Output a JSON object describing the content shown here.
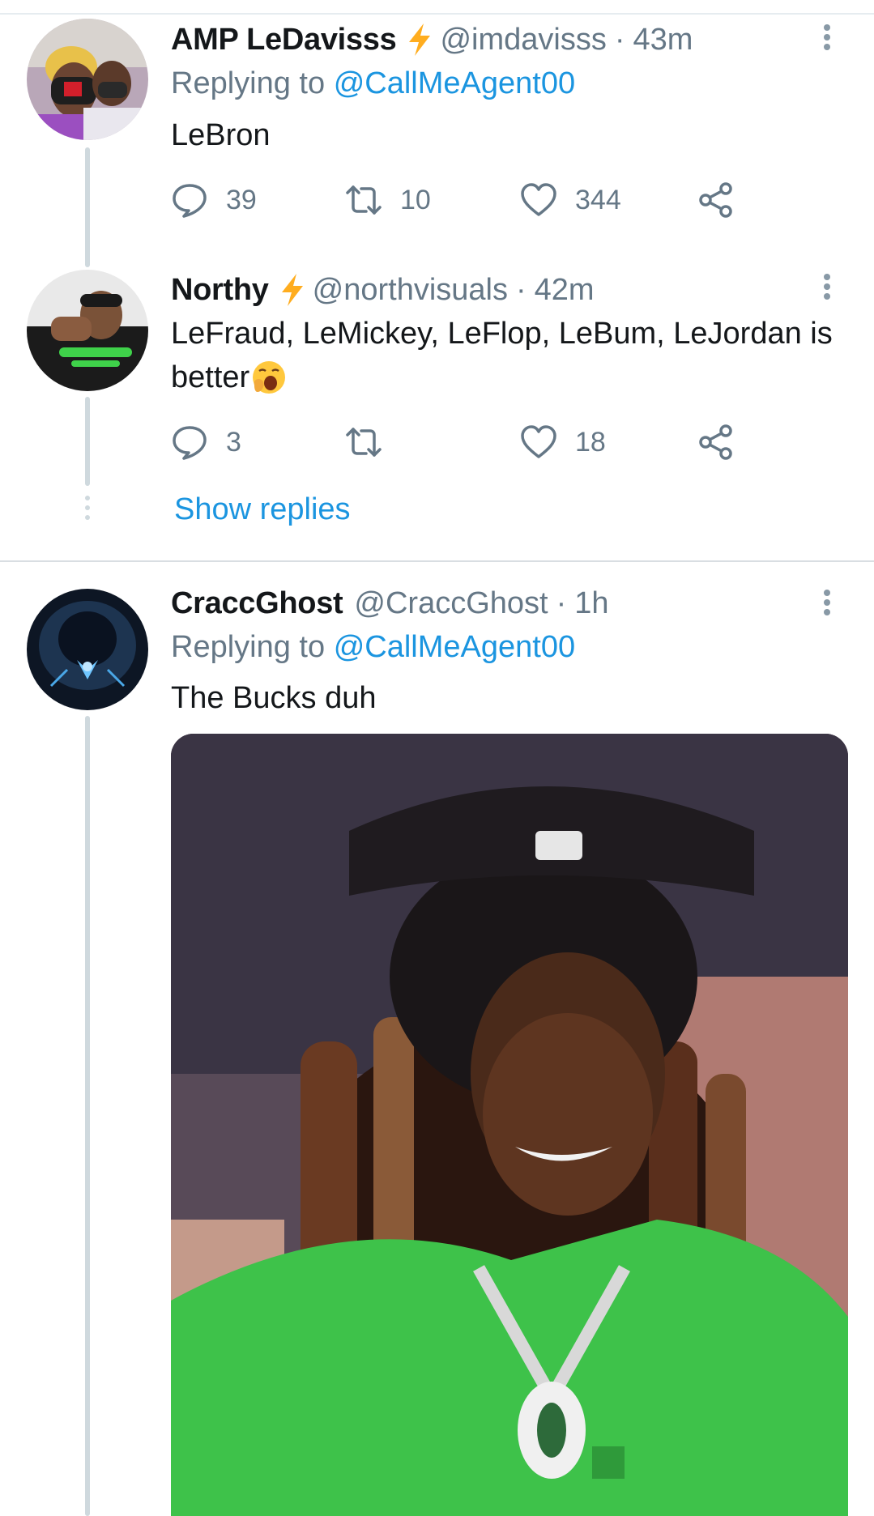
{
  "tweets": [
    {
      "name": "AMP LeDavisss",
      "verified_bolt": true,
      "handle": "@imdavisss",
      "separator": "·",
      "time": "43m",
      "replying_prefix": "Replying to",
      "replying_to": "@CallMeAgent00",
      "text": "LeBron",
      "replies": "39",
      "retweets": "10",
      "likes": "344"
    },
    {
      "name": "Northy",
      "verified_bolt": true,
      "handle": "@northvisuals",
      "separator": "·",
      "time": "42m",
      "text": "LeFraud, LeMickey, LeFlop, LeBum, LeJordan is better",
      "emoji": "yawning-face",
      "replies": "3",
      "retweets": "",
      "likes": "18"
    },
    {
      "name": "CraccGhost",
      "handle": "@CraccGhost",
      "separator": "·",
      "time": "1h",
      "replying_prefix": "Replying to",
      "replying_to": "@CallMeAgent00",
      "text": "The Bucks duh",
      "media": "photo-smiling-man-green-shirt"
    }
  ],
  "show_replies": "Show replies",
  "colors": {
    "link": "#1b95e0",
    "muted": "#657786",
    "bolt": "#ffad1f",
    "thread_line": "#cfd9de"
  }
}
